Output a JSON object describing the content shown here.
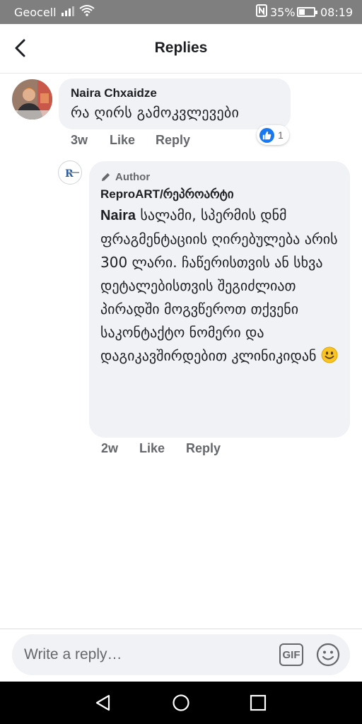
{
  "status_bar": {
    "carrier": "Geocell",
    "battery_percent": "35%",
    "time": "08:19"
  },
  "header": {
    "title": "Replies"
  },
  "comment": {
    "author": "Naira Chxaidze",
    "text": "რა ღირს გამოკვლევები",
    "time": "3w",
    "like_label": "Like",
    "reply_label": "Reply",
    "reaction_count": "1"
  },
  "reply": {
    "badge": "Author",
    "author": "ReproART/რეპროარტი",
    "mention": "Naira",
    "text": "სალამი, სპერმის დნმ ფრაგმენტაციის ღირებულება არის 300 ლარი. ჩაწერისთვის ან სხვა დეტალებისთვის შეგიძლიათ პირადში მოგვწეროთ თქვენი საკონტაქტო ნომერი და დაგიკავშირდებით კლინიკიდან",
    "time": "2w",
    "like_label": "Like",
    "reply_label": "Reply"
  },
  "composer": {
    "placeholder": "Write a reply…",
    "gif_label": "GIF"
  },
  "colors": {
    "accent": "#1877f2",
    "bubble": "#f0f2f5",
    "meta_text": "#65676b"
  },
  "icons": {
    "back": "chevron-left-icon",
    "pencil": "pencil-icon",
    "like": "thumbs-up-icon",
    "emoji": "smiley-icon"
  }
}
